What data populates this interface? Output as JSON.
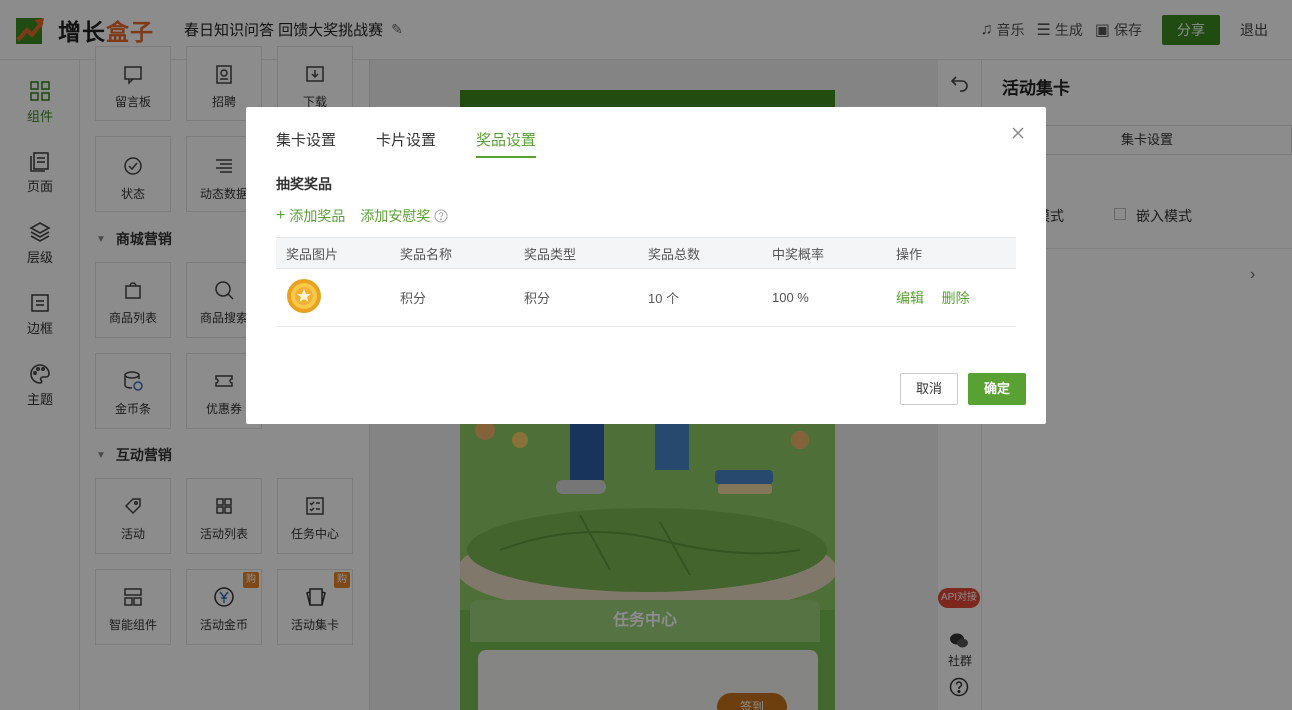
{
  "app": {
    "logo_text_a": "增长",
    "logo_text_b": "盒子",
    "doc_title": "春日知识问答 回馈大奖挑战赛",
    "actions": {
      "music": "音乐",
      "generate": "生成",
      "save": "保存",
      "share": "分享",
      "exit": "退出"
    }
  },
  "rail": [
    {
      "label": "组件",
      "icon": "grid-icon",
      "active": true
    },
    {
      "label": "页面",
      "icon": "pages-icon"
    },
    {
      "label": "层级",
      "icon": "layers-icon"
    },
    {
      "label": "边框",
      "icon": "frame-icon"
    },
    {
      "label": "主题",
      "icon": "palette-icon"
    }
  ],
  "panel": {
    "row0": [
      "留言板",
      "招聘",
      "下载"
    ],
    "row1": [
      "状态",
      "动态数据"
    ],
    "section_mall": "商城营销",
    "row2": [
      "商品列表",
      "商品搜索"
    ],
    "row3": [
      "金币条",
      "优惠券"
    ],
    "section_interactive": "互动营销",
    "row4": [
      "活动",
      "活动列表",
      "任务中心"
    ],
    "row5": [
      "智能组件",
      "活动金币",
      "活动集卡"
    ],
    "badge": "购"
  },
  "phone": {
    "task_title": "任务中心",
    "sign_button": "签到"
  },
  "right_panel": {
    "title": "活动集卡",
    "tab": "集卡设置",
    "mode_label_partial": "式",
    "mode_a_partial": "存模式",
    "mode_b": "嵌入模式",
    "api_tag": "API对接",
    "community": "社群"
  },
  "modal": {
    "tabs": [
      "集卡设置",
      "卡片设置",
      "奖品设置"
    ],
    "active_tab": 2,
    "section": "抽奖奖品",
    "add_prize": "添加奖品",
    "add_consolation": "添加安慰奖",
    "columns": [
      "奖品图片",
      "奖品名称",
      "奖品类型",
      "奖品总数",
      "中奖概率",
      "操作"
    ],
    "rows": [
      {
        "name": "积分",
        "type": "积分",
        "total": "10 个",
        "rate": "100 %",
        "edit": "编辑",
        "delete": "删除"
      }
    ],
    "cancel": "取消",
    "confirm": "确定"
  }
}
